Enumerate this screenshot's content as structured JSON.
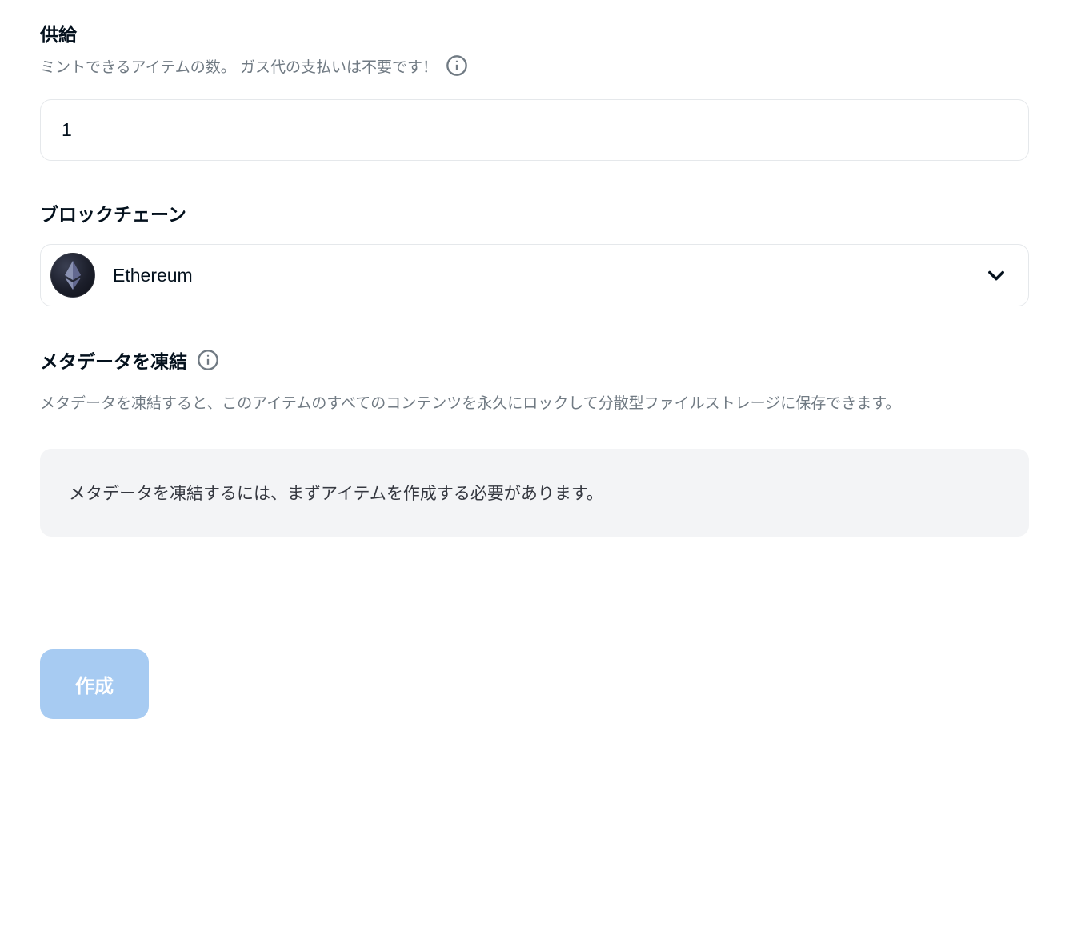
{
  "supply": {
    "label": "供給",
    "description": "ミントできるアイテムの数。 ガス代の支払いは不要です！",
    "value": "1"
  },
  "blockchain": {
    "label": "ブロックチェーン",
    "selected": "Ethereum"
  },
  "freeze": {
    "label": "メタデータを凍結",
    "description": "メタデータを凍結すると、このアイテムのすべてのコンテンツを永久にロックして分散型ファイルストレージに保存できます。",
    "notice": "メタデータを凍結するには、まずアイテムを作成する必要があります。"
  },
  "button": {
    "create": "作成"
  }
}
